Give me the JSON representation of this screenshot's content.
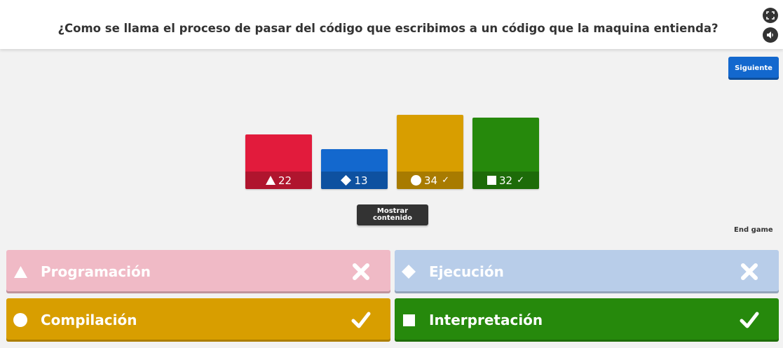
{
  "question": "¿Como se llama el proceso de pasar del código que escribimos a un código que la maquina entienda?",
  "header_icons": [
    "fullscreen-icon",
    "sound-icon"
  ],
  "next_button": "Siguiente",
  "results": [
    {
      "shape": "triangle",
      "count": "22",
      "correct": false,
      "color": "#e21b3c"
    },
    {
      "shape": "diamond",
      "count": "13",
      "correct": false,
      "color": "#1368ce"
    },
    {
      "shape": "circle",
      "count": "34",
      "correct": true,
      "color": "#d89e00"
    },
    {
      "shape": "square",
      "count": "32",
      "correct": true,
      "color": "#26890c"
    }
  ],
  "check_glyph": "✓",
  "show_content_button": "Mostrar contenido",
  "end_game": "End game",
  "answers": [
    {
      "label": "Programación",
      "shape": "triangle",
      "correct": false,
      "color": "#f0bac6"
    },
    {
      "label": "Ejecución",
      "shape": "diamond",
      "correct": false,
      "color": "#b8cde9"
    },
    {
      "label": "Compilación",
      "shape": "circle",
      "correct": true,
      "color": "#d89e00"
    },
    {
      "label": "Interpretación",
      "shape": "square",
      "correct": true,
      "color": "#26890c"
    }
  ]
}
